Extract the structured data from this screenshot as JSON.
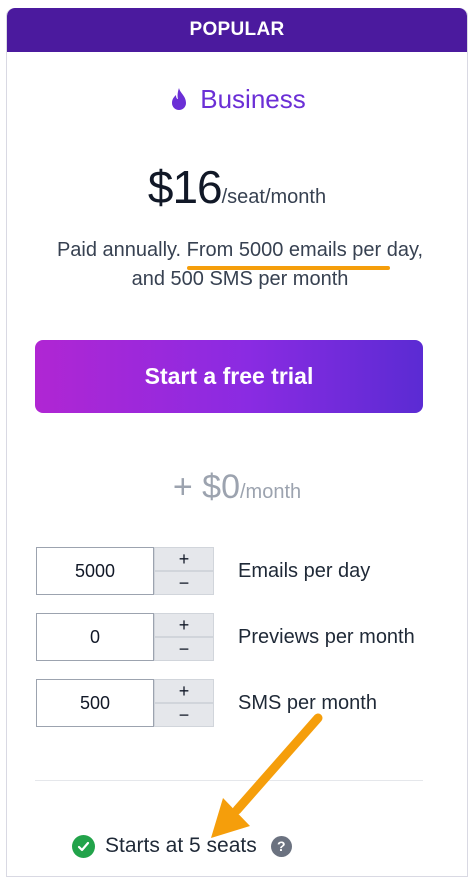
{
  "badge": {
    "label": "POPULAR"
  },
  "plan": {
    "icon": "flame-icon",
    "name": "Business"
  },
  "price": {
    "amount": "$16",
    "period": "/seat/month"
  },
  "description": {
    "before": "Paid annually. ",
    "highlight": "From 5000 emails per",
    "after": " day,",
    "line2": "and 500 SMS per month"
  },
  "cta": {
    "label": "Start a free trial"
  },
  "addon": {
    "amount": "+ $0",
    "period": "/month"
  },
  "quantities": [
    {
      "value": "5000",
      "label": "Emails per day",
      "plus": "+",
      "minus": "−"
    },
    {
      "value": "0",
      "label": "Previews per month",
      "plus": "+",
      "minus": "−"
    },
    {
      "value": "500",
      "label": "SMS per month",
      "plus": "+",
      "minus": "−"
    }
  ],
  "seats": {
    "label": "Starts at 5 seats",
    "help": "?"
  },
  "colors": {
    "badge_bg": "#4b1a9e",
    "accent": "#6b2fd6",
    "highlight_underline": "#f59e0b",
    "annotation_arrow": "#f59e0b",
    "check": "#22a34a"
  }
}
